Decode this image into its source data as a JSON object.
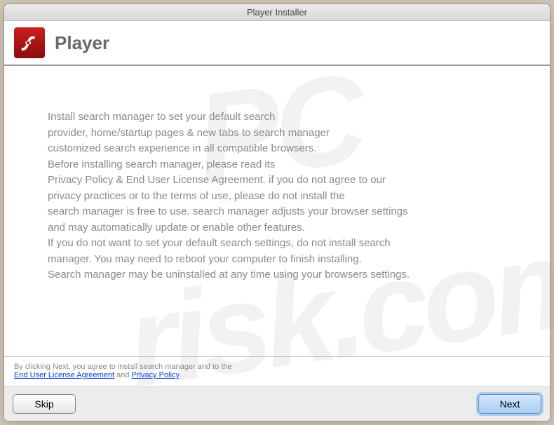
{
  "window": {
    "title": "Player Installer"
  },
  "header": {
    "title": "Player"
  },
  "content": {
    "body": "Install search manager to set your default search\nprovider, home/startup pages & new tabs to search manager\ncustomized search experience in all compatible browsers.\nBefore installing search manager, please read its\nPrivacy Policy & End User License Agreement. if you do not agree to our\nprivacy practices or to the terms of use, please do not install the\nsearch manager is free to use. search manager adjusts your browser settings\nand may automatically update or enable other features.\nIf you do not want to set your default search settings, do not install search\nmanager. You may need to reboot your computer to finish installing.\nSearch manager may be uninstalled at any time using your browsers settings."
  },
  "footer": {
    "prefix": "By clicking Next, you agree to install search manager and to the",
    "eula": "End User License Agreement",
    "and": " and ",
    "privacy": "Privacy Policy",
    "suffix": "."
  },
  "buttons": {
    "skip": "Skip",
    "next": "Next"
  },
  "watermark": {
    "top": "PC",
    "bottom": "risk.com"
  }
}
